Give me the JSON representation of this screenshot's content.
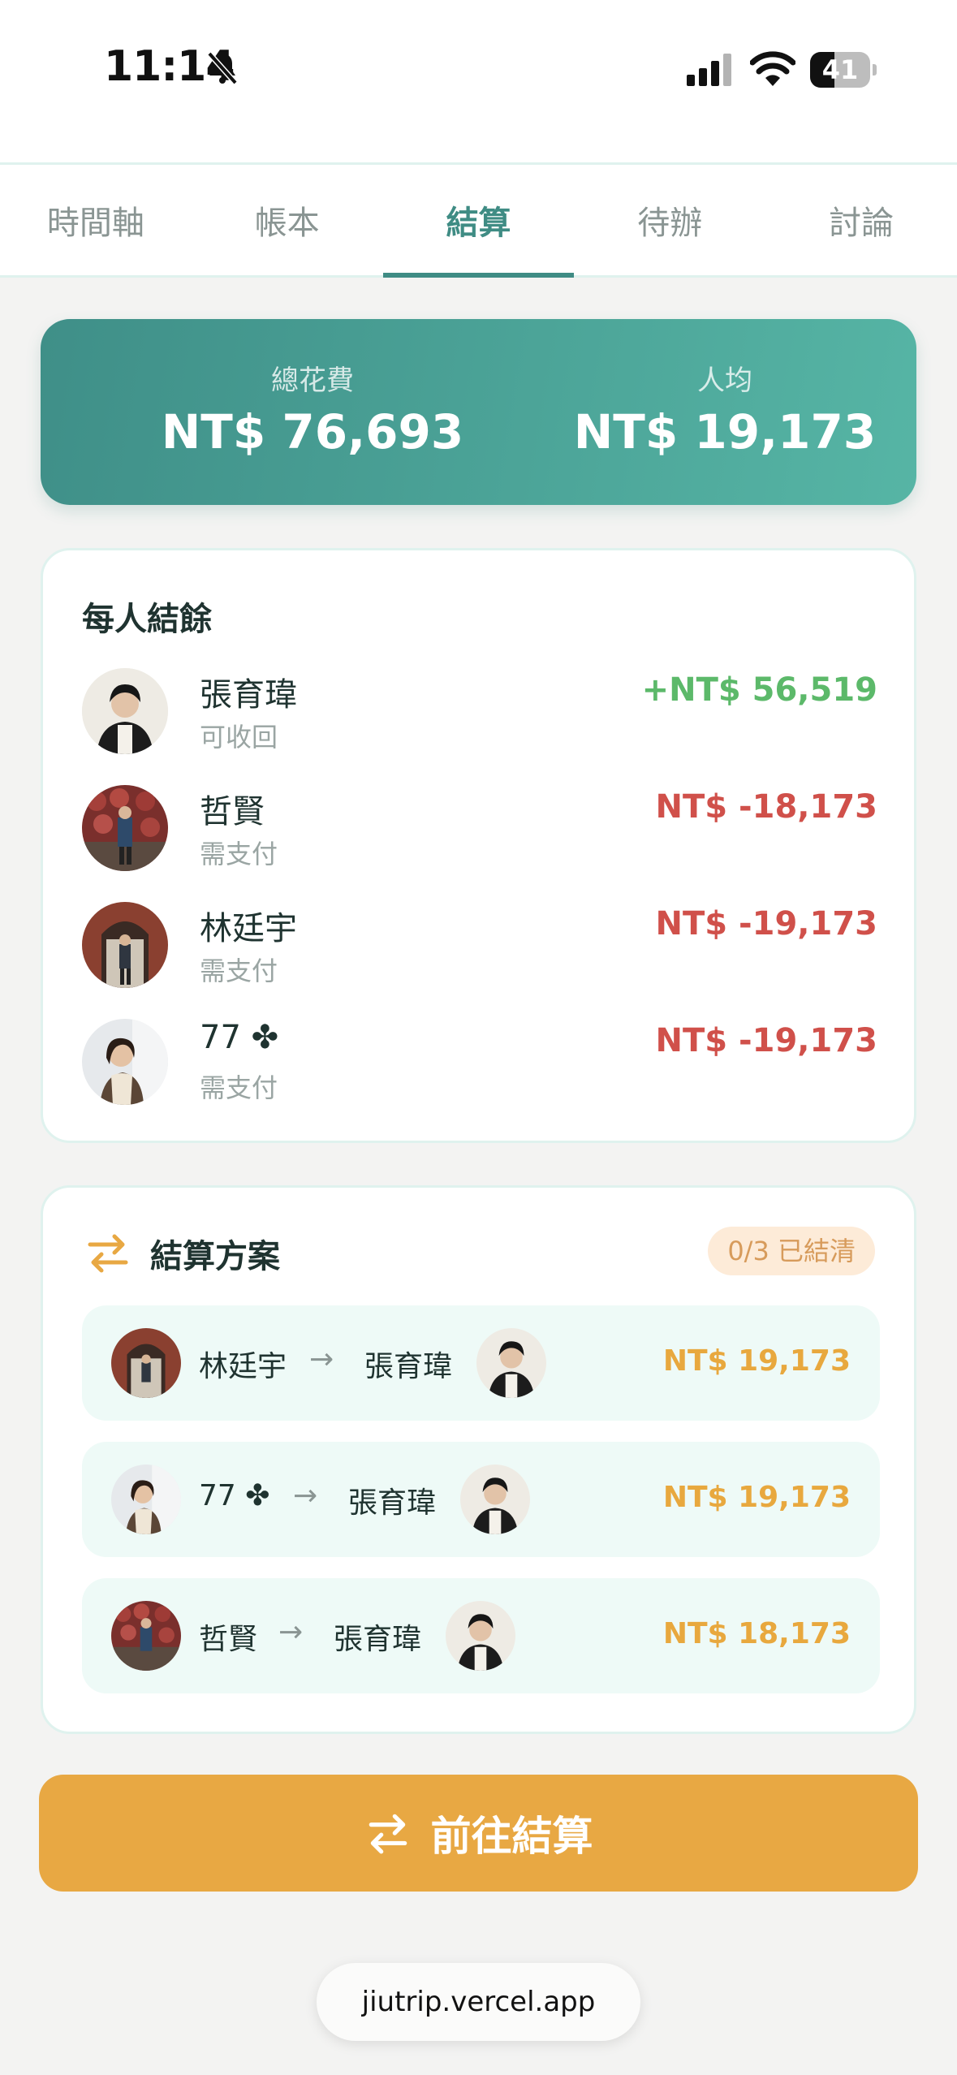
{
  "status_bar": {
    "time": "11:14",
    "battery": "41",
    "battery_level": 0.41,
    "icons": [
      "bell-slash-icon",
      "cellular-signal-icon",
      "wifi-icon",
      "battery-icon"
    ]
  },
  "tabs": [
    {
      "label": "時間軸",
      "active": false
    },
    {
      "label": "帳本",
      "active": false
    },
    {
      "label": "結算",
      "active": true
    },
    {
      "label": "待辦",
      "active": false
    },
    {
      "label": "討論",
      "active": false
    }
  ],
  "summary": {
    "total_label": "總花費",
    "total_value": "NT$ 76,693",
    "avg_label": "人均",
    "avg_value": "NT$ 19,173"
  },
  "balances": {
    "title": "每人結餘",
    "people": [
      {
        "name": "張育瑋",
        "status": "可收回",
        "amount": "+NT$ 56,519",
        "color": "#5cb96a"
      },
      {
        "name": "哲賢",
        "status": "需支付",
        "amount": "NT$ -18,173",
        "color": "#d0504a"
      },
      {
        "name": "林廷宇",
        "status": "需支付",
        "amount": "NT$ -19,173",
        "color": "#d0504a"
      },
      {
        "name": "77 ✤",
        "status": "需支付",
        "amount": "NT$ -19,173",
        "color": "#d0504a"
      }
    ]
  },
  "plan": {
    "title": "結算方案",
    "icon": "swap-arrows-icon",
    "badge": "0/3 已結清",
    "arrow": "→",
    "transfers": [
      {
        "from": "林廷宇",
        "to": "張育瑋",
        "amount": "NT$ 19,173"
      },
      {
        "from": "77 ✤",
        "to": "張育瑋",
        "amount": "NT$ 19,173"
      },
      {
        "from": "哲賢",
        "to": "張育瑋",
        "amount": "NT$ 18,173"
      }
    ]
  },
  "settle_button": {
    "label": "前往結算",
    "icon": "swap-arrows-icon"
  },
  "url": "jiutrip.vercel.app",
  "colors": {
    "accent": "#3f8c84",
    "positive": "#5cb96a",
    "negative": "#d0504a",
    "orange": "#e8a843"
  }
}
